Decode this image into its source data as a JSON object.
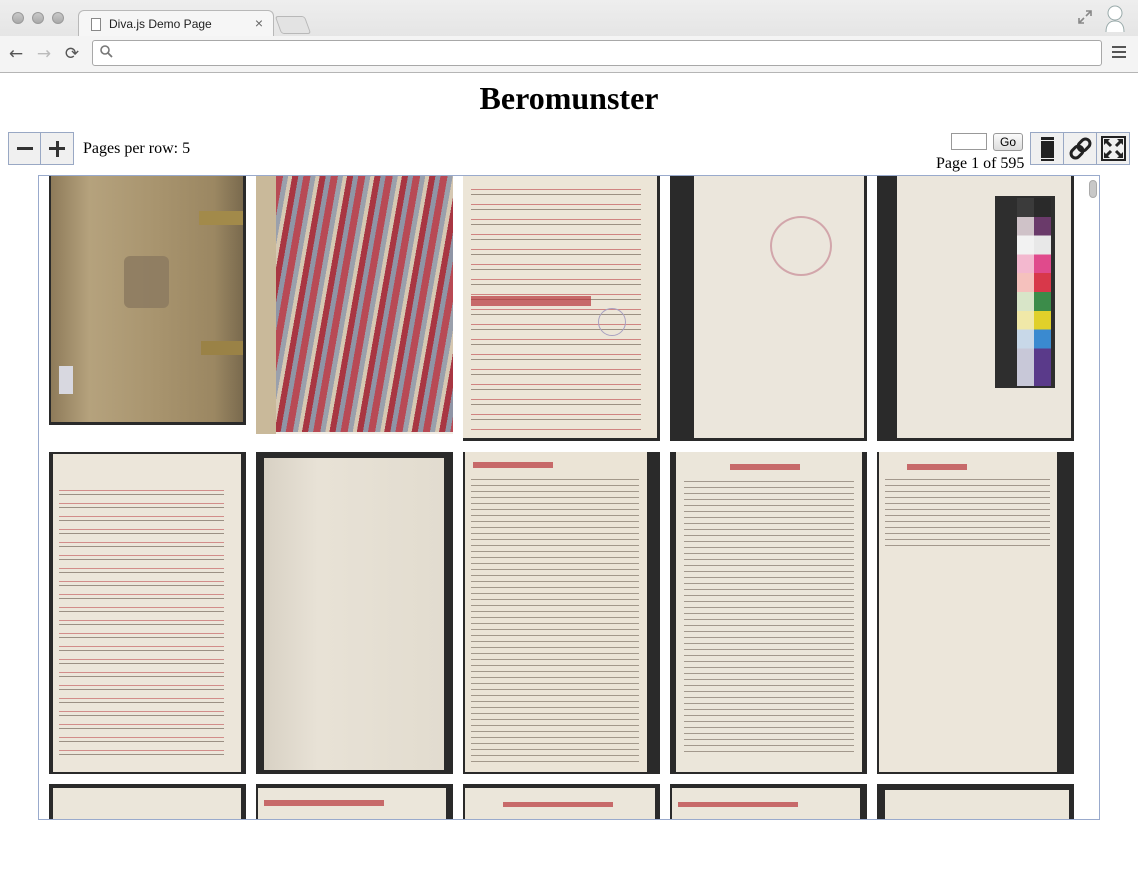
{
  "browser": {
    "tab_title": "Diva.js Demo Page",
    "tab_close": "×",
    "url": "",
    "back_icon": "←",
    "forward_icon": "→",
    "reload_icon": "⟳",
    "search_glyph": "⌕"
  },
  "viewer": {
    "title": "Beromunster",
    "pages_per_row_label": "Pages per row: 5",
    "go_label": "Go",
    "page_label": "Page 1 of 595",
    "page_input_value": ""
  },
  "thumbnails": [
    {
      "desc": "leather-cover"
    },
    {
      "desc": "marbled-endpaper"
    },
    {
      "desc": "index-universalis-title"
    },
    {
      "desc": "blank-stamped-leaf"
    },
    {
      "desc": "blank-leaf-with-color-chart"
    },
    {
      "desc": "list-of-names"
    },
    {
      "desc": "blank-leaf"
    },
    {
      "desc": "epistola-dedicatoria-1"
    },
    {
      "desc": "epistola-dedicatoria-2"
    },
    {
      "desc": "epistola-dedicatoria-3"
    },
    {
      "desc": "partial-leaf-1"
    },
    {
      "desc": "partial-leaf-2"
    },
    {
      "desc": "partial-leaf-3"
    },
    {
      "desc": "partial-leaf-4"
    },
    {
      "desc": "partial-leaf-5"
    }
  ],
  "colors": {
    "accent_border": "#99aacc",
    "parchment": "#e8e2d6",
    "cover_leather": "#a8946e",
    "red_ink": "#b8343b",
    "dark_ink": "#4a3a2e"
  }
}
